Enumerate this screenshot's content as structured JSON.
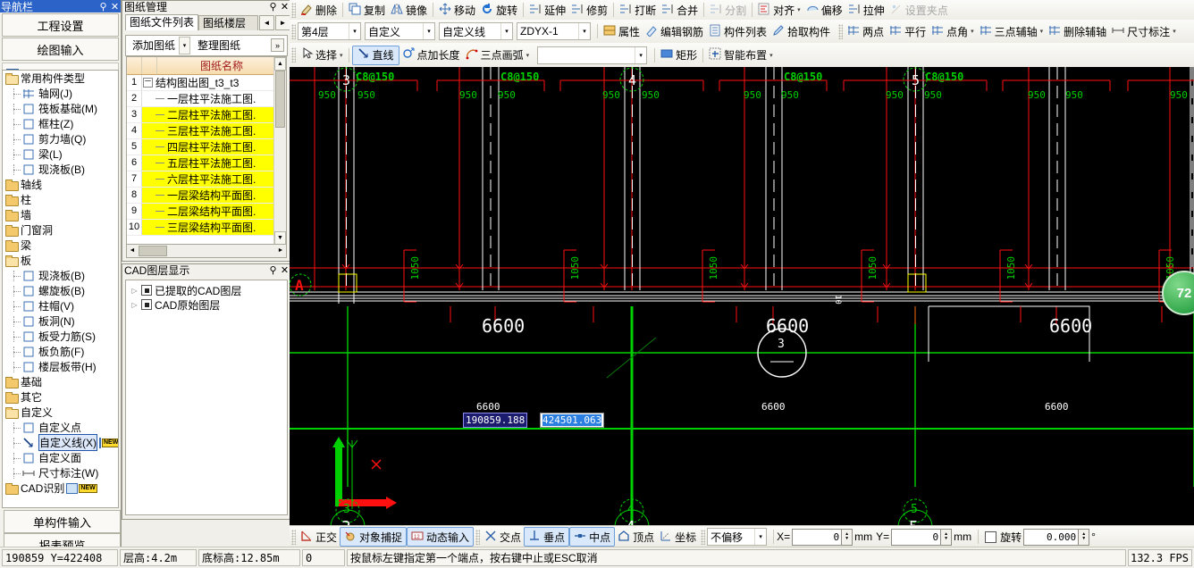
{
  "nav": {
    "title": "导航栏",
    "pin": "📌",
    "close": "✕",
    "buttons": [
      {
        "label": "工程设置"
      },
      {
        "label": "绘图输入"
      }
    ],
    "tree": [
      {
        "label": "常用构件类型",
        "type": "folder-open",
        "indent": 0
      },
      {
        "label": "轴网(J)",
        "type": "leaf",
        "indent": 1,
        "icon": "grid-icon"
      },
      {
        "label": "筏板基础(M)",
        "type": "leaf",
        "indent": 1,
        "icon": "raft-foundation-icon"
      },
      {
        "label": "框柱(Z)",
        "type": "leaf",
        "indent": 1,
        "icon": "frame-column-icon"
      },
      {
        "label": "剪力墙(Q)",
        "type": "leaf",
        "indent": 1,
        "icon": "shear-wall-icon"
      },
      {
        "label": "梁(L)",
        "type": "leaf",
        "indent": 1,
        "icon": "beam-icon"
      },
      {
        "label": "现浇板(B)",
        "type": "leaf",
        "indent": 1,
        "icon": "slab-icon"
      },
      {
        "label": "轴线",
        "type": "folder",
        "indent": 0
      },
      {
        "label": "柱",
        "type": "folder",
        "indent": 0
      },
      {
        "label": "墙",
        "type": "folder",
        "indent": 0
      },
      {
        "label": "门窗洞",
        "type": "folder",
        "indent": 0
      },
      {
        "label": "梁",
        "type": "folder",
        "indent": 0
      },
      {
        "label": "板",
        "type": "folder-open",
        "indent": 0
      },
      {
        "label": "现浇板(B)",
        "type": "leaf",
        "indent": 1,
        "icon": "cast-slab-icon"
      },
      {
        "label": "螺旋板(B)",
        "type": "leaf",
        "indent": 1,
        "icon": "spiral-slab-icon"
      },
      {
        "label": "柱帽(V)",
        "type": "leaf",
        "indent": 1,
        "icon": "column-cap-icon"
      },
      {
        "label": "板洞(N)",
        "type": "leaf",
        "indent": 1,
        "icon": "slab-hole-icon"
      },
      {
        "label": "板受力筋(S)",
        "type": "leaf",
        "indent": 1,
        "icon": "slab-rebar-icon"
      },
      {
        "label": "板负筋(F)",
        "type": "leaf",
        "indent": 1,
        "icon": "slab-negrebar-icon"
      },
      {
        "label": "楼层板带(H)",
        "type": "leaf",
        "indent": 1,
        "icon": "slab-band-icon"
      },
      {
        "label": "基础",
        "type": "folder",
        "indent": 0
      },
      {
        "label": "其它",
        "type": "folder",
        "indent": 0
      },
      {
        "label": "自定义",
        "type": "folder-open",
        "indent": 0
      },
      {
        "label": "自定义点",
        "type": "leaf",
        "indent": 1,
        "icon": "custom-point-icon"
      },
      {
        "label": "自定义线(X)",
        "type": "leaf",
        "indent": 1,
        "icon": "custom-line-icon",
        "selected": true,
        "badge": "NEW"
      },
      {
        "label": "自定义面",
        "type": "leaf",
        "indent": 1,
        "icon": "custom-face-icon"
      },
      {
        "label": "尺寸标注(W)",
        "type": "leaf",
        "indent": 1,
        "icon": "dimension-icon"
      },
      {
        "label": "CAD识别",
        "type": "folder",
        "indent": 0,
        "badge": "NEW"
      }
    ],
    "bottom_buttons": [
      {
        "label": "单构件输入"
      },
      {
        "label": "报表预览"
      }
    ]
  },
  "drawing_manager": {
    "title": "图纸管理",
    "pin": "📌",
    "close": "✕",
    "tabs": [
      {
        "label": "图纸文件列表",
        "active": true
      },
      {
        "label": "图纸楼层对",
        "active": false
      }
    ],
    "tab_prev": "◄",
    "tab_next": "►",
    "chevron": "»",
    "commands": [
      {
        "label": "添加图纸",
        "has_arrow": true
      },
      {
        "label": "整理图纸",
        "has_arrow": false
      }
    ],
    "grid_header": "图纸名称",
    "rows": [
      {
        "n": "1",
        "name": "结构图出图_t3_t3",
        "expander": "－",
        "highlight": false,
        "indent": 0
      },
      {
        "n": "2",
        "name": "一层柱平法施工图.",
        "highlight": false,
        "indent": 1
      },
      {
        "n": "3",
        "name": "二层柱平法施工图.",
        "highlight": true,
        "indent": 1
      },
      {
        "n": "4",
        "name": "三层柱平法施工图.",
        "highlight": true,
        "indent": 1
      },
      {
        "n": "5",
        "name": "四层柱平法施工图.",
        "highlight": true,
        "indent": 1
      },
      {
        "n": "6",
        "name": "五层柱平法施工图.",
        "highlight": true,
        "indent": 1
      },
      {
        "n": "7",
        "name": "六层柱平法施工图.",
        "highlight": true,
        "indent": 1
      },
      {
        "n": "8",
        "name": "一层梁结构平面图.",
        "highlight": true,
        "indent": 1
      },
      {
        "n": "9",
        "name": "二层梁结构平面图.",
        "highlight": true,
        "indent": 1
      },
      {
        "n": "10",
        "name": "三层梁结构平面图.",
        "highlight": true,
        "indent": 1
      }
    ]
  },
  "cad_layer": {
    "title": "CAD图层显示",
    "pin": "📌",
    "close": "✕",
    "items": [
      {
        "label": "已提取的CAD图层",
        "checked": true
      },
      {
        "label": "CAD原始图层",
        "checked": true
      }
    ]
  },
  "toolbar1": [
    {
      "label": "删除",
      "icon": "delete-icon",
      "disabled": false
    },
    {
      "label": "复制",
      "icon": "copy-icon",
      "disabled": false
    },
    {
      "label": "镜像",
      "icon": "mirror-icon",
      "disabled": false
    },
    {
      "label": "移动",
      "icon": "move-icon",
      "disabled": false
    },
    {
      "label": "旋转",
      "icon": "rotate-icon",
      "disabled": false
    },
    {
      "label": "延伸",
      "icon": "extend-icon",
      "disabled": false
    },
    {
      "label": "修剪",
      "icon": "trim-icon",
      "disabled": false
    },
    {
      "label": "打断",
      "icon": "break-icon",
      "disabled": false
    },
    {
      "label": "合并",
      "icon": "merge-icon",
      "disabled": false
    },
    {
      "label": "分割",
      "icon": "split-icon",
      "disabled": true
    },
    {
      "label": "对齐",
      "icon": "align-icon",
      "disabled": false,
      "has_arrow": true
    },
    {
      "label": "偏移",
      "icon": "offset-icon",
      "disabled": false
    },
    {
      "label": "拉伸",
      "icon": "stretch-icon",
      "disabled": false
    },
    {
      "label": "设置夹点",
      "icon": "gripper-icon",
      "disabled": true
    }
  ],
  "toolbar2": {
    "selects": [
      {
        "value": "第4层",
        "name": "floor-select"
      },
      {
        "value": "自定义",
        "name": "category-select"
      },
      {
        "value": "自定义线",
        "name": "component-type-select"
      },
      {
        "value": "ZDYX-1",
        "name": "component-name-select"
      }
    ],
    "buttons": [
      {
        "label": "属性",
        "icon": "properties-icon"
      },
      {
        "label": "编辑钢筋",
        "icon": "edit-rebar-icon"
      },
      {
        "label": "构件列表",
        "icon": "component-list-icon"
      },
      {
        "label": "拾取构件",
        "icon": "pick-component-icon"
      }
    ],
    "axis_tools": [
      {
        "label": "两点",
        "icon": "two-point-icon",
        "has_arrow": false
      },
      {
        "label": "平行",
        "icon": "parallel-icon",
        "has_arrow": false
      },
      {
        "label": "点角",
        "icon": "point-angle-icon",
        "has_arrow": true
      },
      {
        "label": "三点辅轴",
        "icon": "three-point-axis-icon",
        "has_arrow": true
      },
      {
        "label": "删除辅轴",
        "icon": "delete-axis-icon",
        "has_arrow": false
      },
      {
        "label": "尺寸标注",
        "icon": "dimension-tool-icon",
        "has_arrow": true
      }
    ]
  },
  "toolbar3": [
    {
      "label": "选择",
      "icon": "select-arrow-icon",
      "has_arrow": true,
      "active": false
    },
    {
      "label": "直线",
      "icon": "line-icon",
      "has_arrow": false,
      "active": true
    },
    {
      "label": "点加长度",
      "icon": "point-length-icon",
      "has_arrow": false,
      "active": false
    },
    {
      "label": "三点画弧",
      "icon": "three-point-arc-icon",
      "has_arrow": true,
      "active": false
    },
    {
      "label": "",
      "icon": "empty-combo",
      "is_combo": true
    },
    {
      "label": "矩形",
      "icon": "rectangle-icon",
      "has_arrow": false,
      "active": false
    },
    {
      "label": "智能布置",
      "icon": "smart-layout-icon",
      "has_arrow": true,
      "active": false
    }
  ],
  "canvas": {
    "rebar_labels": [
      "C8@150",
      "C8@150",
      "C8@150",
      "C8@150",
      "C8@150"
    ],
    "dim_950": "950",
    "dim_1050": "1050",
    "dim_6600": "6600",
    "dim_10": "10",
    "axis_circles_top": [
      "3",
      "4",
      "5"
    ],
    "axis_circles_bottom": [
      "3",
      "4",
      "5"
    ],
    "axis_letter_left": "A",
    "axis_letter_right": "A",
    "marker_circle": "3",
    "marker_circle_sub": "-",
    "input_x": "190859.188",
    "input_y": "424501.063",
    "badge_value": "72",
    "ucs_x": "X",
    "ucs_y": "Y"
  },
  "statusbar": {
    "left_tools": [
      {
        "label": "正交",
        "icon": "ortho-icon",
        "active": false
      },
      {
        "label": "对象捕捉",
        "icon": "osnap-icon",
        "active": true
      },
      {
        "label": "动态输入",
        "icon": "dyninput-icon",
        "active": true
      }
    ],
    "snap_tools": [
      {
        "label": "交点",
        "icon": "intersection-snap-icon",
        "active": false
      },
      {
        "label": "垂点",
        "icon": "perpendicular-snap-icon",
        "active": true
      },
      {
        "label": "中点",
        "icon": "midpoint-snap-icon",
        "active": true
      },
      {
        "label": "顶点",
        "icon": "vertex-snap-icon",
        "active": false
      },
      {
        "label": "坐标",
        "icon": "coordinate-snap-icon",
        "active": false
      }
    ],
    "offset_mode": "不偏移",
    "x_label": "X=",
    "x_value": "0",
    "x_unit": "mm",
    "y_label": "Y=",
    "y_value": "0",
    "y_unit": "mm",
    "rotate_label": "旋转",
    "rotate_value": "0.000",
    "rotate_unit": "°"
  },
  "bottom": {
    "coords": "190859 Y=422408",
    "floor_height": "层高:4.2m",
    "base_elev": "底标高:12.85m",
    "count": "0",
    "hint": "按鼠标左键指定第一个端点，按右键中止或ESC取消",
    "fps": "132.3 FPS"
  }
}
